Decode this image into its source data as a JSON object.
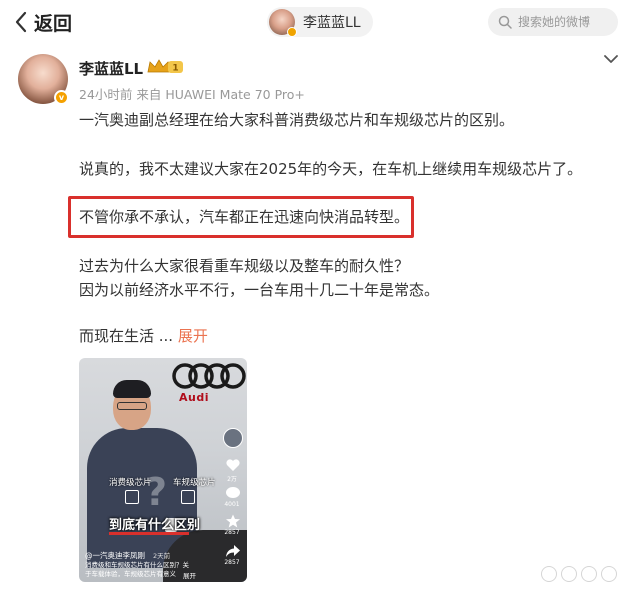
{
  "topbar": {
    "back_label": "返回",
    "user_name": "李蓝蓝LL",
    "search_placeholder": "搜索她的微博"
  },
  "post": {
    "author": "李蓝蓝LL",
    "badge_level": "1",
    "meta": "24小时前 来自 HUAWEI Mate 70 Pro+",
    "paragraphs": {
      "p1": "一汽奥迪副总经理在给大家科普消费级芯片和车规级芯片的区别。",
      "p2": "说真的，我不太建议大家在2025年的今天，在车机上继续用车规级芯片了。",
      "p3": "不管你承不承认，汽车都正在迅速向快消品转型。",
      "p4": "过去为什么大家很看重车规级以及整车的耐久性？",
      "p5": "因为以前经济水平不行，一台车用十几二十年是常态。",
      "p6": "而现在生活 ...",
      "expand": "展开"
    }
  },
  "video": {
    "brand_word": "Audi",
    "chip_left": "消费级芯片",
    "chip_right": "车规级芯片",
    "caption": "到底有什么区别",
    "author": "@一汽奥迪李凤刚",
    "time": "2天前",
    "description": "消费级和车规级芯片有什么区别？关于车载体验，车规级芯片有意义",
    "expand": "展开",
    "likes": "2万",
    "comments": "4001",
    "favorites": "2857",
    "shares": "2857"
  },
  "colors": {
    "highlight": "#d9302c",
    "link": "#eb7350",
    "vip": "#f5a100"
  }
}
